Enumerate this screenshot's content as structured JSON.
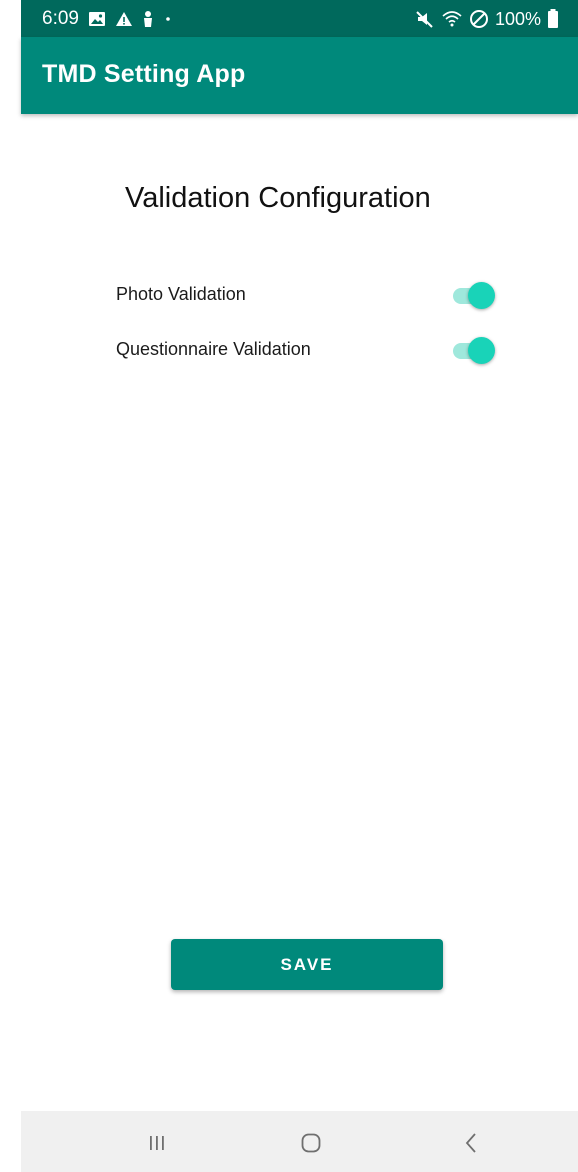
{
  "status_bar": {
    "time": "6:09",
    "battery": "100%",
    "icons_left": [
      "gallery-icon",
      "alert-triangle-icon",
      "person-icon",
      "dot-icon"
    ],
    "icons_right": [
      "mute-icon",
      "wifi-icon",
      "do-not-disturb-icon",
      "battery-icon"
    ]
  },
  "app_bar": {
    "title": "TMD Setting App"
  },
  "main": {
    "heading": "Validation Configuration",
    "settings": [
      {
        "label": "Photo Validation",
        "enabled": true
      },
      {
        "label": "Questionnaire Validation",
        "enabled": true
      }
    ],
    "save_label": "SAVE"
  },
  "nav_bar": {
    "buttons": [
      "recents-icon",
      "home-icon",
      "back-icon"
    ]
  },
  "colors": {
    "status_bar": "#00695c",
    "app_bar": "#00897b",
    "switch_thumb": "#19d3b8",
    "switch_track": "#9fe8dc",
    "button": "#00897b"
  }
}
